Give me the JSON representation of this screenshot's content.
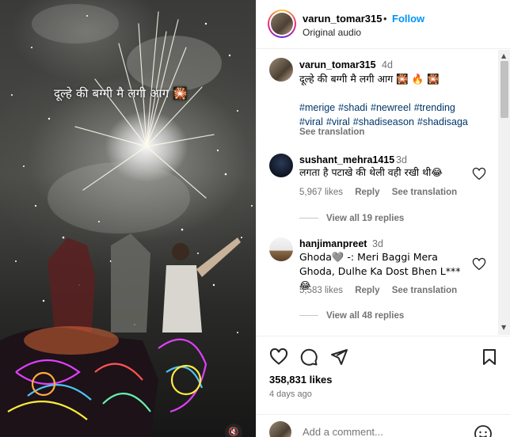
{
  "video": {
    "caption": "दूल्हे की बग्गी मै लगी आग 🎇",
    "mute_icon": "speaker-muted-icon"
  },
  "header": {
    "username": "varun_tomar315",
    "dot": "•",
    "follow_label": "Follow",
    "audio": "Original audio"
  },
  "caption": {
    "username": "varun_tomar315",
    "time": "4d",
    "text": "दूल्हे की बग्गी मै लगी आग 🎇 🔥 🎇",
    "hashtags": [
      "#merige",
      "#shadi",
      "#newreel",
      "#trending",
      "#viral",
      "#viral",
      "#shadiseason",
      "#shadisaga"
    ],
    "see_translation": "See translation"
  },
  "comments": [
    {
      "username": "sushant_mehra1415",
      "time": "3d",
      "text": "लगता है पटाखे की थेली वही रखी थी😂",
      "likes": "5,967 likes",
      "reply_label": "Reply",
      "translation_label": "See translation",
      "replies_label": "View all 19 replies"
    },
    {
      "username": "hanjimanpreet",
      "time": "3d",
      "text": "Ghoda🩶 -: Meri Baggi Mera Ghoda, Dulhe Ka Dost Bhen L*** 😂",
      "likes": "5,583 likes",
      "reply_label": "Reply",
      "translation_label": "See translation",
      "replies_label": "View all 48 replies"
    }
  ],
  "stats": {
    "likes": "358,831 likes",
    "time_ago": "4 days ago"
  },
  "add_comment": {
    "placeholder": "Add a comment..."
  },
  "colors": {
    "follow_blue": "#0095f6",
    "hashtag": "#00376b",
    "muted_text": "#737373"
  }
}
